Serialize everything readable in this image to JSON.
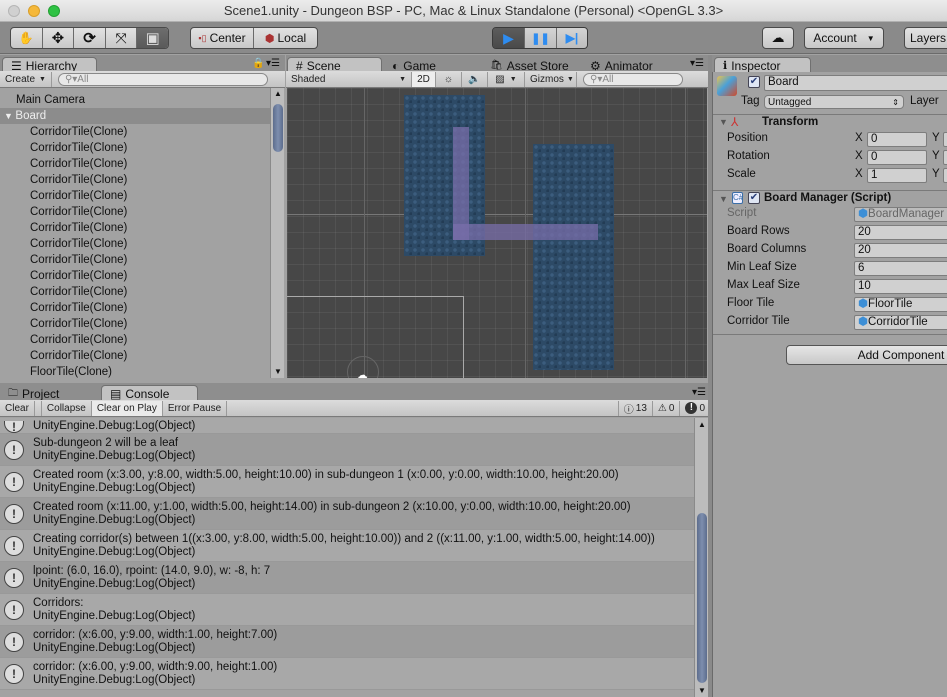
{
  "window": {
    "title": "Scene1.unity - Dungeon BSP - PC, Mac & Linux Standalone (Personal) <OpenGL 3.3>"
  },
  "toolbar": {
    "tools": [
      {
        "name": "hand-tool",
        "glyph": "✋"
      },
      {
        "name": "move-tool",
        "glyph": "✥"
      },
      {
        "name": "rotate-tool",
        "glyph": "⟳"
      },
      {
        "name": "scale-tool",
        "glyph": "⤧"
      },
      {
        "name": "rect-tool",
        "glyph": "▣"
      }
    ],
    "pivot_label": "Center",
    "space_label": "Local",
    "play_glyph": "▶",
    "pause_glyph": "❚❚",
    "step_glyph": "▶|",
    "cloud_glyph": "☁",
    "account_label": "Account",
    "layers_label": "Layers"
  },
  "hierarchy": {
    "tab_label": "Hierarchy",
    "create_label": "Create",
    "search_placeholder": "All",
    "items": [
      {
        "label": "Main Camera",
        "depth": 0
      },
      {
        "label": "Board",
        "depth": 0,
        "selected": true,
        "expanded": true
      },
      {
        "label": "CorridorTile(Clone)",
        "depth": 1
      },
      {
        "label": "CorridorTile(Clone)",
        "depth": 1
      },
      {
        "label": "CorridorTile(Clone)",
        "depth": 1
      },
      {
        "label": "CorridorTile(Clone)",
        "depth": 1
      },
      {
        "label": "CorridorTile(Clone)",
        "depth": 1
      },
      {
        "label": "CorridorTile(Clone)",
        "depth": 1
      },
      {
        "label": "CorridorTile(Clone)",
        "depth": 1
      },
      {
        "label": "CorridorTile(Clone)",
        "depth": 1
      },
      {
        "label": "CorridorTile(Clone)",
        "depth": 1
      },
      {
        "label": "CorridorTile(Clone)",
        "depth": 1
      },
      {
        "label": "CorridorTile(Clone)",
        "depth": 1
      },
      {
        "label": "CorridorTile(Clone)",
        "depth": 1
      },
      {
        "label": "CorridorTile(Clone)",
        "depth": 1
      },
      {
        "label": "CorridorTile(Clone)",
        "depth": 1
      },
      {
        "label": "CorridorTile(Clone)",
        "depth": 1
      },
      {
        "label": "FloorTile(Clone)",
        "depth": 1
      }
    ]
  },
  "scene": {
    "tabs": [
      {
        "label": "Scene",
        "glyph": "#",
        "active": true
      },
      {
        "label": "Game",
        "glyph": "◐"
      },
      {
        "label": "Asset Store",
        "glyph": "🛍"
      },
      {
        "label": "Animator",
        "glyph": "⚙"
      }
    ],
    "shading_mode": "Shaded",
    "mode_2d_label": "2D",
    "gizmos_label": "Gizmos",
    "search_placeholder": "All"
  },
  "inspector": {
    "tab_label": "Inspector",
    "object_name": "Board",
    "active_checked": true,
    "tag_label": "Tag",
    "tag_value": "Untagged",
    "layer_label": "Layer",
    "transform": {
      "title": "Transform",
      "rows": [
        {
          "label": "Position",
          "x": "0"
        },
        {
          "label": "Rotation",
          "x": "0"
        },
        {
          "label": "Scale",
          "x": "1"
        }
      ],
      "x_label": "X",
      "y_label": "Y"
    },
    "script_component": {
      "title": "Board Manager (Script)",
      "enabled": true,
      "fields": [
        {
          "label": "Script",
          "value": "BoardManager",
          "disabled": true,
          "ref": true
        },
        {
          "label": "Board Rows",
          "value": "20"
        },
        {
          "label": "Board Columns",
          "value": "20"
        },
        {
          "label": "Min Leaf Size",
          "value": "6"
        },
        {
          "label": "Max Leaf Size",
          "value": "10"
        },
        {
          "label": "Floor Tile",
          "value": "FloorTile",
          "ref": true
        },
        {
          "label": "Corridor Tile",
          "value": "CorridorTile",
          "ref": true
        }
      ]
    },
    "add_component_label": "Add Component"
  },
  "console": {
    "tabs": [
      {
        "label": "Project",
        "glyph": "🗀"
      },
      {
        "label": "Console",
        "glyph": "▤",
        "active": true
      }
    ],
    "buttons": {
      "clear": "Clear",
      "collapse": "Collapse",
      "clear_on_play": "Clear on Play",
      "error_pause": "Error Pause"
    },
    "counts": {
      "info": "13",
      "warnings": "0",
      "errors": "0"
    },
    "entries": [
      {
        "line1": "",
        "line2": "UnityEngine.Debug:Log(Object)"
      },
      {
        "line1": "Sub-dungeon 2 will be a leaf",
        "line2": "UnityEngine.Debug:Log(Object)"
      },
      {
        "line1": "Created room (x:3.00, y:8.00, width:5.00, height:10.00) in sub-dungeon 1 (x:0.00, y:0.00, width:10.00, height:20.00)",
        "line2": "UnityEngine.Debug:Log(Object)"
      },
      {
        "line1": "Created room (x:11.00, y:1.00, width:5.00, height:14.00) in sub-dungeon 2 (x:10.00, y:0.00, width:10.00, height:20.00)",
        "line2": "UnityEngine.Debug:Log(Object)"
      },
      {
        "line1": "Creating corridor(s) between 1((x:3.00, y:8.00, width:5.00, height:10.00)) and 2 ((x:11.00, y:1.00, width:5.00, height:14.00))",
        "line2": "UnityEngine.Debug:Log(Object)"
      },
      {
        "line1": "lpoint: (6.0, 16.0), rpoint: (14.0, 9.0), w: -8, h: 7",
        "line2": "UnityEngine.Debug:Log(Object)"
      },
      {
        "line1": "Corridors:",
        "line2": "UnityEngine.Debug:Log(Object)"
      },
      {
        "line1": "corridor: (x:6.00, y:9.00, width:1.00, height:7.00)",
        "line2": "UnityEngine.Debug:Log(Object)"
      },
      {
        "line1": "corridor: (x:6.00, y:9.00, width:9.00, height:1.00)",
        "line2": "UnityEngine.Debug:Log(Object)"
      }
    ],
    "scroll_fraction": 0.6
  }
}
